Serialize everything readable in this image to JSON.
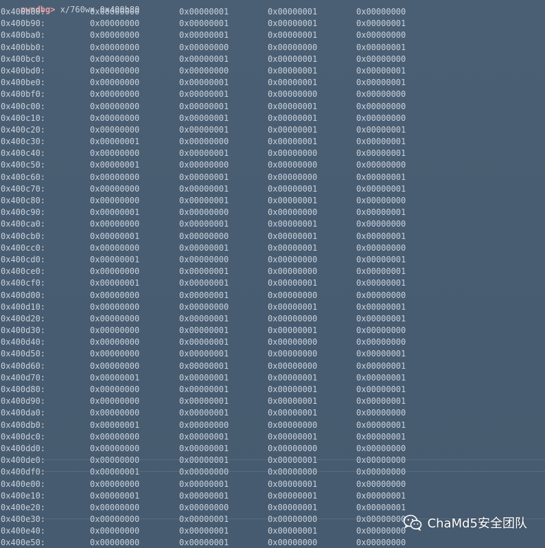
{
  "prompt": {
    "label": "pwndbg>",
    "command": " x/760wx 0x400b80"
  },
  "rows": [
    [
      "0x400b80:",
      "0x00000000",
      "0x00000001",
      "0x00000001",
      "0x00000000"
    ],
    [
      "0x400b90:",
      "0x00000000",
      "0x00000001",
      "0x00000001",
      "0x00000001"
    ],
    [
      "0x400ba0:",
      "0x00000000",
      "0x00000001",
      "0x00000001",
      "0x00000000"
    ],
    [
      "0x400bb0:",
      "0x00000000",
      "0x00000000",
      "0x00000000",
      "0x00000001"
    ],
    [
      "0x400bc0:",
      "0x00000000",
      "0x00000001",
      "0x00000001",
      "0x00000000"
    ],
    [
      "0x400bd0:",
      "0x00000000",
      "0x00000000",
      "0x00000001",
      "0x00000001"
    ],
    [
      "0x400be0:",
      "0x00000000",
      "0x00000001",
      "0x00000001",
      "0x00000001"
    ],
    [
      "0x400bf0:",
      "0x00000000",
      "0x00000001",
      "0x00000000",
      "0x00000000"
    ],
    [
      "0x400c00:",
      "0x00000000",
      "0x00000001",
      "0x00000001",
      "0x00000000"
    ],
    [
      "0x400c10:",
      "0x00000000",
      "0x00000001",
      "0x00000001",
      "0x00000000"
    ],
    [
      "0x400c20:",
      "0x00000000",
      "0x00000001",
      "0x00000001",
      "0x00000001"
    ],
    [
      "0x400c30:",
      "0x00000001",
      "0x00000000",
      "0x00000001",
      "0x00000001"
    ],
    [
      "0x400c40:",
      "0x00000000",
      "0x00000001",
      "0x00000000",
      "0x00000001"
    ],
    [
      "0x400c50:",
      "0x00000001",
      "0x00000000",
      "0x00000000",
      "0x00000000"
    ],
    [
      "0x400c60:",
      "0x00000000",
      "0x00000001",
      "0x00000000",
      "0x00000001"
    ],
    [
      "0x400c70:",
      "0x00000000",
      "0x00000001",
      "0x00000001",
      "0x00000001"
    ],
    [
      "0x400c80:",
      "0x00000000",
      "0x00000001",
      "0x00000001",
      "0x00000000"
    ],
    [
      "0x400c90:",
      "0x00000001",
      "0x00000000",
      "0x00000000",
      "0x00000001"
    ],
    [
      "0x400ca0:",
      "0x00000000",
      "0x00000001",
      "0x00000001",
      "0x00000000"
    ],
    [
      "0x400cb0:",
      "0x00000001",
      "0x00000000",
      "0x00000001",
      "0x00000001"
    ],
    [
      "0x400cc0:",
      "0x00000000",
      "0x00000001",
      "0x00000001",
      "0x00000000"
    ],
    [
      "0x400cd0:",
      "0x00000001",
      "0x00000000",
      "0x00000000",
      "0x00000001"
    ],
    [
      "0x400ce0:",
      "0x00000000",
      "0x00000001",
      "0x00000000",
      "0x00000001"
    ],
    [
      "0x400cf0:",
      "0x00000001",
      "0x00000001",
      "0x00000001",
      "0x00000001"
    ],
    [
      "0x400d00:",
      "0x00000000",
      "0x00000001",
      "0x00000000",
      "0x00000000"
    ],
    [
      "0x400d10:",
      "0x00000000",
      "0x00000000",
      "0x00000001",
      "0x00000001"
    ],
    [
      "0x400d20:",
      "0x00000000",
      "0x00000001",
      "0x00000000",
      "0x00000001"
    ],
    [
      "0x400d30:",
      "0x00000000",
      "0x00000001",
      "0x00000001",
      "0x00000000"
    ],
    [
      "0x400d40:",
      "0x00000000",
      "0x00000001",
      "0x00000000",
      "0x00000000"
    ],
    [
      "0x400d50:",
      "0x00000000",
      "0x00000001",
      "0x00000000",
      "0x00000001"
    ],
    [
      "0x400d60:",
      "0x00000000",
      "0x00000001",
      "0x00000000",
      "0x00000001"
    ],
    [
      "0x400d70:",
      "0x00000001",
      "0x00000001",
      "0x00000001",
      "0x00000001"
    ],
    [
      "0x400d80:",
      "0x00000000",
      "0x00000001",
      "0x00000001",
      "0x00000001"
    ],
    [
      "0x400d90:",
      "0x00000000",
      "0x00000001",
      "0x00000001",
      "0x00000001"
    ],
    [
      "0x400da0:",
      "0x00000000",
      "0x00000001",
      "0x00000001",
      "0x00000000"
    ],
    [
      "0x400db0:",
      "0x00000001",
      "0x00000000",
      "0x00000000",
      "0x00000001"
    ],
    [
      "0x400dc0:",
      "0x00000000",
      "0x00000001",
      "0x00000001",
      "0x00000001"
    ],
    [
      "0x400dd0:",
      "0x00000000",
      "0x00000001",
      "0x00000000",
      "0x00000000"
    ],
    [
      "0x400de0:",
      "0x00000000",
      "0x00000001",
      "0x00000001",
      "0x00000000"
    ],
    [
      "0x400df0:",
      "0x00000001",
      "0x00000000",
      "0x00000000",
      "0x00000000"
    ],
    [
      "0x400e00:",
      "0x00000000",
      "0x00000001",
      "0x00000001",
      "0x00000000"
    ],
    [
      "0x400e10:",
      "0x00000001",
      "0x00000001",
      "0x00000001",
      "0x00000001"
    ],
    [
      "0x400e20:",
      "0x00000000",
      "0x00000000",
      "0x00000001",
      "0x00000001"
    ],
    [
      "0x400e30:",
      "0x00000000",
      "0x00000001",
      "0x00000000",
      "0x00000000"
    ],
    [
      "0x400e40:",
      "0x00000000",
      "0x00000001",
      "0x00000001",
      "0x00000000"
    ],
    [
      "0x400e50:",
      "0x00000000",
      "0x00000001",
      "0x00000000",
      "0x00000000"
    ]
  ],
  "watermark": {
    "text": "ChaMd5安全团队",
    "icon": "wechat-icon"
  },
  "colors": {
    "background": "#485c71",
    "text": "#c9d2dc",
    "prompt": "#e8a0a8"
  }
}
